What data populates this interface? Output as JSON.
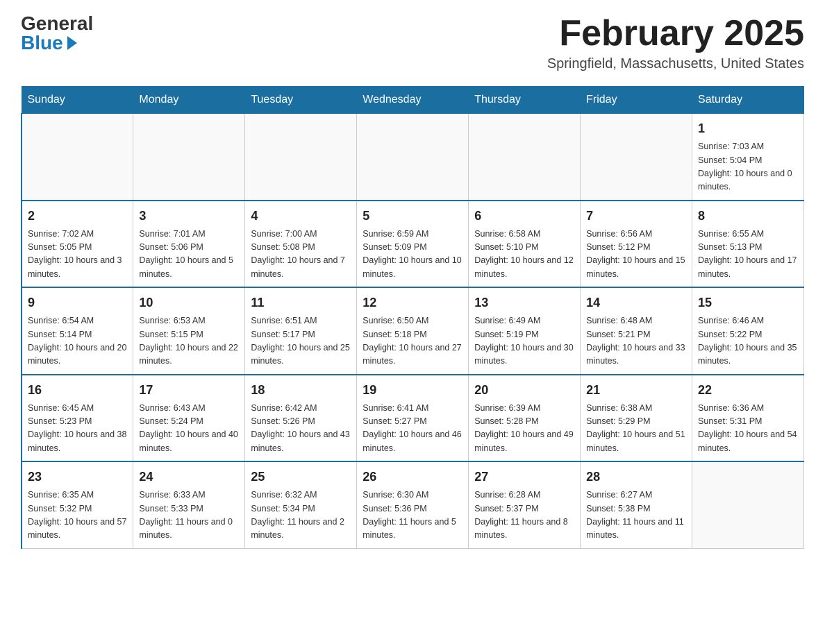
{
  "header": {
    "logo_general": "General",
    "logo_blue": "Blue",
    "month_title": "February 2025",
    "location": "Springfield, Massachusetts, United States"
  },
  "days_of_week": [
    "Sunday",
    "Monday",
    "Tuesday",
    "Wednesday",
    "Thursday",
    "Friday",
    "Saturday"
  ],
  "weeks": [
    [
      {
        "day": "",
        "sunrise": "",
        "sunset": "",
        "daylight": ""
      },
      {
        "day": "",
        "sunrise": "",
        "sunset": "",
        "daylight": ""
      },
      {
        "day": "",
        "sunrise": "",
        "sunset": "",
        "daylight": ""
      },
      {
        "day": "",
        "sunrise": "",
        "sunset": "",
        "daylight": ""
      },
      {
        "day": "",
        "sunrise": "",
        "sunset": "",
        "daylight": ""
      },
      {
        "day": "",
        "sunrise": "",
        "sunset": "",
        "daylight": ""
      },
      {
        "day": "1",
        "sunrise": "Sunrise: 7:03 AM",
        "sunset": "Sunset: 5:04 PM",
        "daylight": "Daylight: 10 hours and 0 minutes."
      }
    ],
    [
      {
        "day": "2",
        "sunrise": "Sunrise: 7:02 AM",
        "sunset": "Sunset: 5:05 PM",
        "daylight": "Daylight: 10 hours and 3 minutes."
      },
      {
        "day": "3",
        "sunrise": "Sunrise: 7:01 AM",
        "sunset": "Sunset: 5:06 PM",
        "daylight": "Daylight: 10 hours and 5 minutes."
      },
      {
        "day": "4",
        "sunrise": "Sunrise: 7:00 AM",
        "sunset": "Sunset: 5:08 PM",
        "daylight": "Daylight: 10 hours and 7 minutes."
      },
      {
        "day": "5",
        "sunrise": "Sunrise: 6:59 AM",
        "sunset": "Sunset: 5:09 PM",
        "daylight": "Daylight: 10 hours and 10 minutes."
      },
      {
        "day": "6",
        "sunrise": "Sunrise: 6:58 AM",
        "sunset": "Sunset: 5:10 PM",
        "daylight": "Daylight: 10 hours and 12 minutes."
      },
      {
        "day": "7",
        "sunrise": "Sunrise: 6:56 AM",
        "sunset": "Sunset: 5:12 PM",
        "daylight": "Daylight: 10 hours and 15 minutes."
      },
      {
        "day": "8",
        "sunrise": "Sunrise: 6:55 AM",
        "sunset": "Sunset: 5:13 PM",
        "daylight": "Daylight: 10 hours and 17 minutes."
      }
    ],
    [
      {
        "day": "9",
        "sunrise": "Sunrise: 6:54 AM",
        "sunset": "Sunset: 5:14 PM",
        "daylight": "Daylight: 10 hours and 20 minutes."
      },
      {
        "day": "10",
        "sunrise": "Sunrise: 6:53 AM",
        "sunset": "Sunset: 5:15 PM",
        "daylight": "Daylight: 10 hours and 22 minutes."
      },
      {
        "day": "11",
        "sunrise": "Sunrise: 6:51 AM",
        "sunset": "Sunset: 5:17 PM",
        "daylight": "Daylight: 10 hours and 25 minutes."
      },
      {
        "day": "12",
        "sunrise": "Sunrise: 6:50 AM",
        "sunset": "Sunset: 5:18 PM",
        "daylight": "Daylight: 10 hours and 27 minutes."
      },
      {
        "day": "13",
        "sunrise": "Sunrise: 6:49 AM",
        "sunset": "Sunset: 5:19 PM",
        "daylight": "Daylight: 10 hours and 30 minutes."
      },
      {
        "day": "14",
        "sunrise": "Sunrise: 6:48 AM",
        "sunset": "Sunset: 5:21 PM",
        "daylight": "Daylight: 10 hours and 33 minutes."
      },
      {
        "day": "15",
        "sunrise": "Sunrise: 6:46 AM",
        "sunset": "Sunset: 5:22 PM",
        "daylight": "Daylight: 10 hours and 35 minutes."
      }
    ],
    [
      {
        "day": "16",
        "sunrise": "Sunrise: 6:45 AM",
        "sunset": "Sunset: 5:23 PM",
        "daylight": "Daylight: 10 hours and 38 minutes."
      },
      {
        "day": "17",
        "sunrise": "Sunrise: 6:43 AM",
        "sunset": "Sunset: 5:24 PM",
        "daylight": "Daylight: 10 hours and 40 minutes."
      },
      {
        "day": "18",
        "sunrise": "Sunrise: 6:42 AM",
        "sunset": "Sunset: 5:26 PM",
        "daylight": "Daylight: 10 hours and 43 minutes."
      },
      {
        "day": "19",
        "sunrise": "Sunrise: 6:41 AM",
        "sunset": "Sunset: 5:27 PM",
        "daylight": "Daylight: 10 hours and 46 minutes."
      },
      {
        "day": "20",
        "sunrise": "Sunrise: 6:39 AM",
        "sunset": "Sunset: 5:28 PM",
        "daylight": "Daylight: 10 hours and 49 minutes."
      },
      {
        "day": "21",
        "sunrise": "Sunrise: 6:38 AM",
        "sunset": "Sunset: 5:29 PM",
        "daylight": "Daylight: 10 hours and 51 minutes."
      },
      {
        "day": "22",
        "sunrise": "Sunrise: 6:36 AM",
        "sunset": "Sunset: 5:31 PM",
        "daylight": "Daylight: 10 hours and 54 minutes."
      }
    ],
    [
      {
        "day": "23",
        "sunrise": "Sunrise: 6:35 AM",
        "sunset": "Sunset: 5:32 PM",
        "daylight": "Daylight: 10 hours and 57 minutes."
      },
      {
        "day": "24",
        "sunrise": "Sunrise: 6:33 AM",
        "sunset": "Sunset: 5:33 PM",
        "daylight": "Daylight: 11 hours and 0 minutes."
      },
      {
        "day": "25",
        "sunrise": "Sunrise: 6:32 AM",
        "sunset": "Sunset: 5:34 PM",
        "daylight": "Daylight: 11 hours and 2 minutes."
      },
      {
        "day": "26",
        "sunrise": "Sunrise: 6:30 AM",
        "sunset": "Sunset: 5:36 PM",
        "daylight": "Daylight: 11 hours and 5 minutes."
      },
      {
        "day": "27",
        "sunrise": "Sunrise: 6:28 AM",
        "sunset": "Sunset: 5:37 PM",
        "daylight": "Daylight: 11 hours and 8 minutes."
      },
      {
        "day": "28",
        "sunrise": "Sunrise: 6:27 AM",
        "sunset": "Sunset: 5:38 PM",
        "daylight": "Daylight: 11 hours and 11 minutes."
      },
      {
        "day": "",
        "sunrise": "",
        "sunset": "",
        "daylight": ""
      }
    ]
  ]
}
